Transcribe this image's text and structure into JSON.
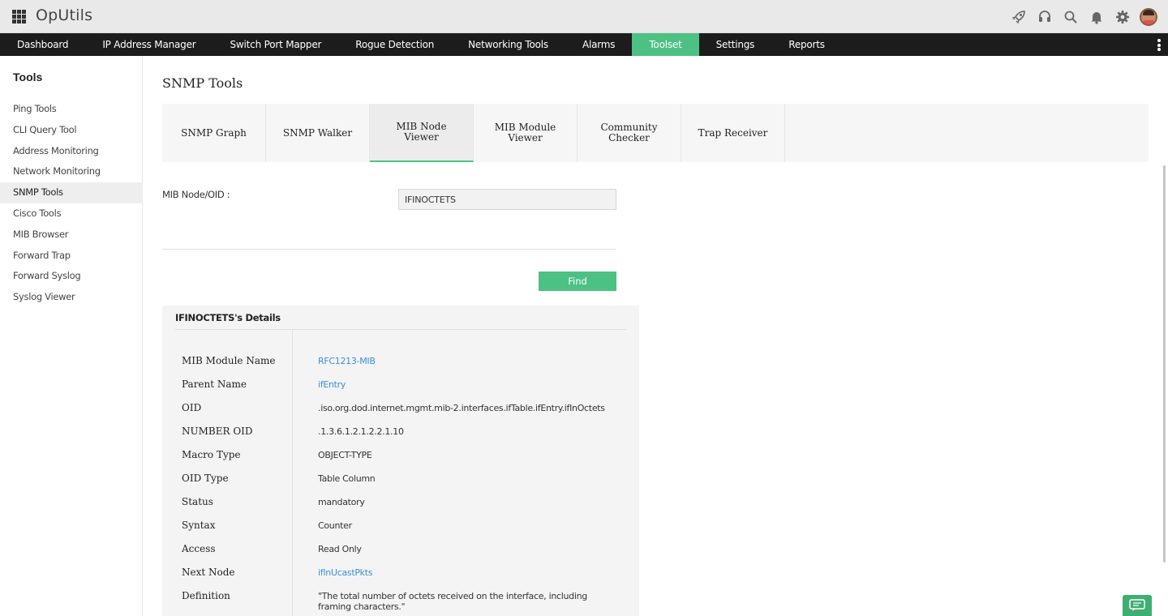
{
  "app": {
    "title": "OpUtils"
  },
  "nav": {
    "items": [
      {
        "label": "Dashboard"
      },
      {
        "label": "IP Address Manager"
      },
      {
        "label": "Switch Port Mapper"
      },
      {
        "label": "Rogue Detection"
      },
      {
        "label": "Networking Tools"
      },
      {
        "label": "Alarms"
      },
      {
        "label": "Toolset",
        "active": true
      },
      {
        "label": "Settings"
      },
      {
        "label": "Reports"
      }
    ]
  },
  "icons": {
    "header": [
      "rocket-icon",
      "headset-icon",
      "search-icon",
      "bell-icon",
      "gear-icon",
      "user-avatar"
    ],
    "accent": "#4cc183",
    "link": "#3b8fd6"
  },
  "sidebar": {
    "title": "Tools",
    "items": [
      {
        "label": "Ping Tools"
      },
      {
        "label": "CLI Query Tool"
      },
      {
        "label": "Address Monitoring"
      },
      {
        "label": "Network Monitoring"
      },
      {
        "label": "SNMP Tools",
        "active": true
      },
      {
        "label": "Cisco Tools"
      },
      {
        "label": "MIB Browser"
      },
      {
        "label": "Forward Trap"
      },
      {
        "label": "Forward Syslog"
      },
      {
        "label": "Syslog Viewer"
      }
    ]
  },
  "main": {
    "title": "SNMP Tools",
    "tabs": [
      {
        "label": "SNMP Graph"
      },
      {
        "label": "SNMP Walker"
      },
      {
        "label": "MIB Node Viewer",
        "active": true
      },
      {
        "label": "MIB Module Viewer"
      },
      {
        "label": "Community Checker"
      },
      {
        "label": "Trap Receiver"
      }
    ],
    "form": {
      "label": "MIB Node/OID :",
      "value": "IFINOCTETS",
      "find_label": "Find"
    },
    "details": {
      "title": "IFINOCTETS's Details",
      "rows": [
        {
          "key": "MIB Module Name",
          "value": "RFC1213-MIB",
          "link": true
        },
        {
          "key": "Parent Name",
          "value": "ifEntry",
          "link": true
        },
        {
          "key": "OID",
          "value": ".iso.org.dod.internet.mgmt.mib-2.interfaces.ifTable.ifEntry.ifInOctets",
          "link": false
        },
        {
          "key": "NUMBER OID",
          "value": ".1.3.6.1.2.1.2.2.1.10",
          "link": false
        },
        {
          "key": "Macro Type",
          "value": "OBJECT-TYPE",
          "link": false
        },
        {
          "key": "OID Type",
          "value": "Table Column",
          "link": false
        },
        {
          "key": "Status",
          "value": "mandatory",
          "link": false
        },
        {
          "key": "Syntax",
          "value": "Counter",
          "link": false
        },
        {
          "key": "Access",
          "value": "Read Only",
          "link": false
        },
        {
          "key": "Next Node",
          "value": "ifInUcastPkts",
          "link": true
        },
        {
          "key": "Definition",
          "value": "\"The total number of octets received on the interface, including framing characters.\"",
          "link": false
        }
      ]
    }
  }
}
